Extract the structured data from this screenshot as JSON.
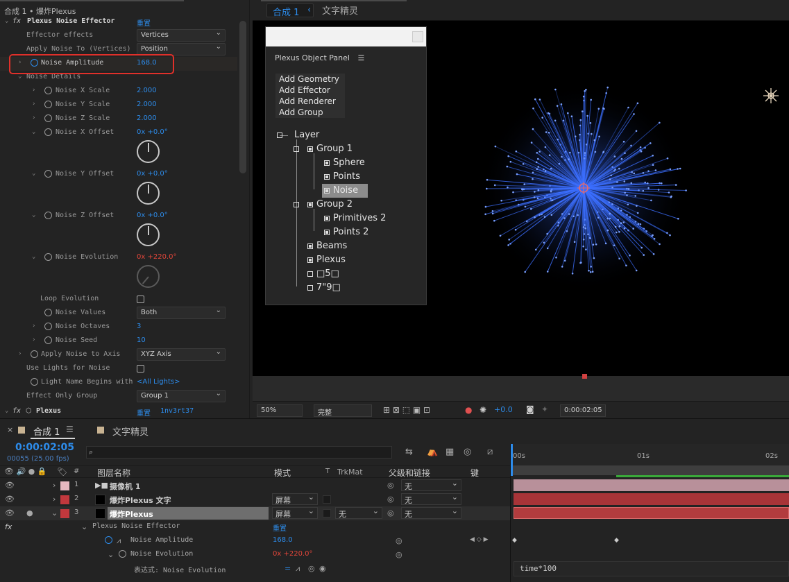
{
  "effect_panel": {
    "title": "合成 1 • 爆炸Plexus",
    "effect_name": "Plexus Noise Effector",
    "reset_label": "重置",
    "rows": {
      "effector_effects_label": "Effector effects",
      "effector_effects_value": "Vertices",
      "apply_noise_label": "Apply Noise To (Vertices)",
      "apply_noise_value": "Position",
      "noise_amplitude_label": "Noise Amplitude",
      "noise_amplitude_value": "168.0",
      "noise_details_label": "Noise Details",
      "noise_x_scale_label": "Noise X Scale",
      "noise_x_scale_value": "2.000",
      "noise_y_scale_label": "Noise Y Scale",
      "noise_y_scale_value": "2.000",
      "noise_z_scale_label": "Noise Z Scale",
      "noise_z_scale_value": "2.000",
      "noise_x_offset_label": "Noise X Offset",
      "noise_x_offset_rev": "0x",
      "noise_x_offset_deg": "+0.0°",
      "noise_y_offset_label": "Noise Y Offset",
      "noise_y_offset_rev": "0x",
      "noise_y_offset_deg": "+0.0°",
      "noise_z_offset_label": "Noise Z Offset",
      "noise_z_offset_rev": "0x",
      "noise_z_offset_deg": "+0.0°",
      "noise_evolution_label": "Noise Evolution",
      "noise_evolution_rev": "0x",
      "noise_evolution_deg": "+220.0°",
      "loop_evolution_label": "Loop Evolution",
      "noise_values_label": "Noise Values",
      "noise_values_value": "Both",
      "noise_octaves_label": "Noise Octaves",
      "noise_octaves_value": "3",
      "noise_seed_label": "Noise Seed",
      "noise_seed_value": "10",
      "apply_noise_axis_label": "Apply Noise to Axis",
      "apply_noise_axis_value": "XYZ Axis",
      "use_lights_label": "Use Lights for Noise",
      "light_name_label": "Light Name Begins with",
      "light_name_value": "<All Lights>",
      "effect_only_group_label": "Effect Only Group",
      "effect_only_group_value": "Group 1",
      "plexus_label": "Plexus",
      "plexus_reset_label": "重置",
      "plexus_key": "1nv3rt37"
    }
  },
  "comp_tabs": {
    "active": "合成 1",
    "other": "文字精灵"
  },
  "plexus_panel": {
    "title": "Plexus Object Panel",
    "menu": [
      "Add Geometry",
      "Add Effector",
      "Add Renderer",
      "Add Group"
    ],
    "tree": {
      "layer": "Layer",
      "group1": "Group 1",
      "sphere": "Sphere",
      "points": "Points",
      "noise": "Noise",
      "group2": "Group 2",
      "primitives2": "Primitives 2",
      "points2": "Points 2",
      "beams": "Beams",
      "plexus": "Plexus",
      "item5": "□5□",
      "item79": "7\"9□"
    }
  },
  "viewer_bar": {
    "zoom": "50%",
    "resolution": "完整",
    "exposure": "+0.0",
    "timecode": "0:00:02:05"
  },
  "timeline": {
    "tab_active": "合成 1",
    "tab_other": "文字精灵",
    "timecode": "0:00:02:05",
    "frame_info": "00055 (25.00 fps)",
    "search_placeholder": "",
    "columns": {
      "layer_name": "图层名称",
      "mode": "模式",
      "t": "T",
      "trkmat": "TrkMat",
      "parent": "父级和链接",
      "keys": "键"
    },
    "ruler": [
      "00s",
      "01s",
      "02s"
    ],
    "layers": [
      {
        "num": "1",
        "name": "摄像机 1",
        "mode": "",
        "trkmat": "",
        "parent": "无",
        "color": "#e6b8c0"
      },
      {
        "num": "2",
        "name": "爆炸Plexus 文字",
        "mode": "屏幕",
        "trkmat": "",
        "parent": "无",
        "color": "#c2383d"
      },
      {
        "num": "3",
        "name": "爆炸Plexus",
        "mode": "屏幕",
        "trkmat": "无",
        "parent": "无",
        "color": "#c2383d"
      }
    ],
    "sub_effect": "Plexus Noise Effector",
    "sub_reset": "重置",
    "sub_amplitude_label": "Noise Amplitude",
    "sub_amplitude_value": "168.0",
    "sub_evolution_label": "Noise Evolution",
    "sub_evolution_rev": "0x",
    "sub_evolution_deg": "+220.0°",
    "expression_label": "表达式: Noise Evolution",
    "expression_text": "time*100"
  }
}
